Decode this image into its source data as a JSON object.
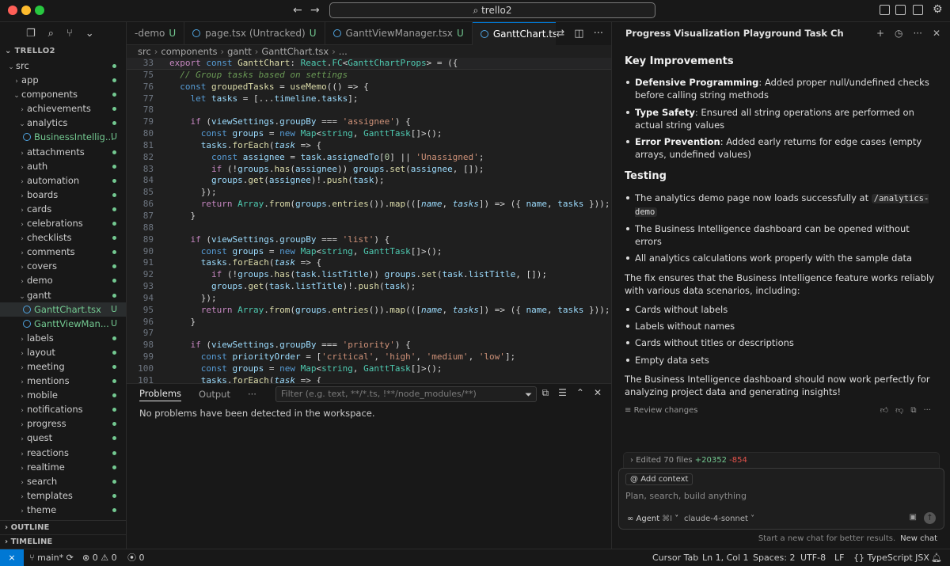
{
  "titlebar": {
    "search_text": "trello2",
    "nav_back": "←",
    "nav_forward": "→"
  },
  "sidebar": {
    "project": "TRELLO2",
    "tree": [
      {
        "label": "src",
        "depth": 0,
        "chev": "⌄",
        "dot": true
      },
      {
        "label": "app",
        "depth": 1,
        "chev": "›",
        "dot": true
      },
      {
        "label": "components",
        "depth": 1,
        "chev": "⌄",
        "dot": true
      },
      {
        "label": "achievements",
        "depth": 2,
        "chev": "›",
        "dot": true
      },
      {
        "label": "analytics",
        "depth": 2,
        "chev": "⌄",
        "dot": true
      },
      {
        "label": "BusinessIntellig...",
        "depth": 3,
        "file": true,
        "badge": "U"
      },
      {
        "label": "attachments",
        "depth": 2,
        "chev": "›",
        "dot": true
      },
      {
        "label": "auth",
        "depth": 2,
        "chev": "›",
        "dot": true
      },
      {
        "label": "automation",
        "depth": 2,
        "chev": "›",
        "dot": true
      },
      {
        "label": "boards",
        "depth": 2,
        "chev": "›",
        "dot": true
      },
      {
        "label": "cards",
        "depth": 2,
        "chev": "›",
        "dot": true
      },
      {
        "label": "celebrations",
        "depth": 2,
        "chev": "›",
        "dot": true
      },
      {
        "label": "checklists",
        "depth": 2,
        "chev": "›",
        "dot": true
      },
      {
        "label": "comments",
        "depth": 2,
        "chev": "›",
        "dot": true
      },
      {
        "label": "covers",
        "depth": 2,
        "chev": "›",
        "dot": true
      },
      {
        "label": "demo",
        "depth": 2,
        "chev": "›",
        "dot": true
      },
      {
        "label": "gantt",
        "depth": 2,
        "chev": "⌄",
        "dot": true
      },
      {
        "label": "GanttChart.tsx",
        "depth": 3,
        "file": true,
        "badge": "U",
        "selected": true
      },
      {
        "label": "GanttViewMan...",
        "depth": 3,
        "file": true,
        "badge": "U"
      },
      {
        "label": "labels",
        "depth": 2,
        "chev": "›",
        "dot": true
      },
      {
        "label": "layout",
        "depth": 2,
        "chev": "›",
        "dot": true
      },
      {
        "label": "meeting",
        "depth": 2,
        "chev": "›",
        "dot": true
      },
      {
        "label": "mentions",
        "depth": 2,
        "chev": "›",
        "dot": true
      },
      {
        "label": "mobile",
        "depth": 2,
        "chev": "›",
        "dot": true
      },
      {
        "label": "notifications",
        "depth": 2,
        "chev": "›",
        "dot": true
      },
      {
        "label": "progress",
        "depth": 2,
        "chev": "›",
        "dot": true
      },
      {
        "label": "quest",
        "depth": 2,
        "chev": "›",
        "dot": true
      },
      {
        "label": "reactions",
        "depth": 2,
        "chev": "›",
        "dot": true
      },
      {
        "label": "realtime",
        "depth": 2,
        "chev": "›",
        "dot": true
      },
      {
        "label": "search",
        "depth": 2,
        "chev": "›",
        "dot": true
      },
      {
        "label": "templates",
        "depth": 2,
        "chev": "›",
        "dot": true
      },
      {
        "label": "theme",
        "depth": 2,
        "chev": "›",
        "dot": true
      }
    ],
    "outline": "OUTLINE",
    "timeline": "TIMELINE"
  },
  "tabs": [
    {
      "label": "-demo",
      "badge": "U",
      "active": false,
      "icon": false
    },
    {
      "label": "page.tsx (Untracked)",
      "badge": "U",
      "active": false,
      "icon": true
    },
    {
      "label": "GanttViewManager.tsx",
      "badge": "U",
      "active": false,
      "icon": true
    },
    {
      "label": "GanttChart.tsx",
      "badge": "U",
      "active": true,
      "icon": true
    }
  ],
  "breadcrumb": [
    "src",
    "components",
    "gantt",
    "GanttChart.tsx",
    "..."
  ],
  "code": {
    "sticky": {
      "ln": "33",
      "html": "<span class=\"kw\">export</span> <span class=\"k2\">const</span> <span class=\"fn\">GanttChart</span><span class=\"pl\">: </span><span class=\"ty\">React</span><span class=\"pl\">.</span><span class=\"ty\">FC</span><span class=\"pl\">&lt;</span><span class=\"ty\">GanttChartProps</span><span class=\"pl\">&gt; = ({</span>"
    },
    "lines": [
      {
        "ln": "75",
        "html": "  <span class=\"cm\">// Group tasks based on settings</span>"
      },
      {
        "ln": "76",
        "html": "  <span class=\"k2\">const</span> <span class=\"fn\">groupedTasks</span> <span class=\"pl\">=</span> <span class=\"fn\">useMemo</span><span class=\"pl\">(() =&gt; {</span>"
      },
      {
        "ln": "77",
        "html": "    <span class=\"k2\">let</span> <span class=\"vr\">tasks</span> <span class=\"pl\">= [...</span><span class=\"vr\">timeline</span><span class=\"pl\">.</span><span class=\"vr\">tasks</span><span class=\"pl\">];</span>"
      },
      {
        "ln": "78",
        "html": ""
      },
      {
        "ln": "79",
        "html": "    <span class=\"kw\">if</span> <span class=\"pl\">(</span><span class=\"vr\">viewSettings</span><span class=\"pl\">.</span><span class=\"vr\">groupBy</span> <span class=\"pl\">===</span> <span class=\"str\">'assignee'</span><span class=\"pl\">) {</span>"
      },
      {
        "ln": "80",
        "html": "      <span class=\"k2\">const</span> <span class=\"vr\">groups</span> <span class=\"pl\">=</span> <span class=\"k2\">new</span> <span class=\"ty\">Map</span><span class=\"pl\">&lt;</span><span class=\"ty\">string</span><span class=\"pl\">, </span><span class=\"ty\">GanttTask</span><span class=\"pl\">[]&gt;();</span>"
      },
      {
        "ln": "81",
        "html": "      <span class=\"vr\">tasks</span><span class=\"pl\">.</span><span class=\"fn\">forEach</span><span class=\"pl\">(</span><span class=\"it\">task</span> <span class=\"pl\">=&gt; {</span>"
      },
      {
        "ln": "82",
        "html": "        <span class=\"k2\">const</span> <span class=\"vr\">assignee</span> <span class=\"pl\">=</span> <span class=\"vr\">task</span><span class=\"pl\">.</span><span class=\"vr\">assignedTo</span><span class=\"pl\">[</span><span class=\"num\">0</span><span class=\"pl\">] ||</span> <span class=\"str\">'Unassigned'</span><span class=\"pl\">;</span>"
      },
      {
        "ln": "83",
        "html": "        <span class=\"kw\">if</span> <span class=\"pl\">(!</span><span class=\"vr\">groups</span><span class=\"pl\">.</span><span class=\"fn\">has</span><span class=\"pl\">(</span><span class=\"vr\">assignee</span><span class=\"pl\">)) </span><span class=\"vr\">groups</span><span class=\"pl\">.</span><span class=\"fn\">set</span><span class=\"pl\">(</span><span class=\"vr\">assignee</span><span class=\"pl\">, []);</span>"
      },
      {
        "ln": "84",
        "html": "        <span class=\"vr\">groups</span><span class=\"pl\">.</span><span class=\"fn\">get</span><span class=\"pl\">(</span><span class=\"vr\">assignee</span><span class=\"pl\">)!.</span><span class=\"fn\">push</span><span class=\"pl\">(</span><span class=\"vr\">task</span><span class=\"pl\">);</span>"
      },
      {
        "ln": "85",
        "html": "      <span class=\"pl\">});</span>"
      },
      {
        "ln": "86",
        "html": "      <span class=\"kw\">return</span> <span class=\"ty\">Array</span><span class=\"pl\">.</span><span class=\"fn\">from</span><span class=\"pl\">(</span><span class=\"vr\">groups</span><span class=\"pl\">.</span><span class=\"fn\">entries</span><span class=\"pl\">()).</span><span class=\"fn\">map</span><span class=\"pl\">(([</span><span class=\"it\">name</span><span class=\"pl\">, </span><span class=\"it\">tasks</span><span class=\"pl\">]) =&gt; ({ </span><span class=\"vr\">name</span><span class=\"pl\">, </span><span class=\"vr\">tasks</span> <span class=\"pl\">}));</span>"
      },
      {
        "ln": "87",
        "html": "    <span class=\"pl\">}</span>"
      },
      {
        "ln": "88",
        "html": ""
      },
      {
        "ln": "89",
        "html": "    <span class=\"kw\">if</span> <span class=\"pl\">(</span><span class=\"vr\">viewSettings</span><span class=\"pl\">.</span><span class=\"vr\">groupBy</span> <span class=\"pl\">===</span> <span class=\"str\">'list'</span><span class=\"pl\">) {</span>"
      },
      {
        "ln": "90",
        "html": "      <span class=\"k2\">const</span> <span class=\"vr\">groups</span> <span class=\"pl\">=</span> <span class=\"k2\">new</span> <span class=\"ty\">Map</span><span class=\"pl\">&lt;</span><span class=\"ty\">string</span><span class=\"pl\">, </span><span class=\"ty\">GanttTask</span><span class=\"pl\">[]&gt;();</span>"
      },
      {
        "ln": "91",
        "html": "      <span class=\"vr\">tasks</span><span class=\"pl\">.</span><span class=\"fn\">forEach</span><span class=\"pl\">(</span><span class=\"it\">task</span> <span class=\"pl\">=&gt; {</span>"
      },
      {
        "ln": "92",
        "html": "        <span class=\"kw\">if</span> <span class=\"pl\">(!</span><span class=\"vr\">groups</span><span class=\"pl\">.</span><span class=\"fn\">has</span><span class=\"pl\">(</span><span class=\"vr\">task</span><span class=\"pl\">.</span><span class=\"vr\">listTitle</span><span class=\"pl\">)) </span><span class=\"vr\">groups</span><span class=\"pl\">.</span><span class=\"fn\">set</span><span class=\"pl\">(</span><span class=\"vr\">task</span><span class=\"pl\">.</span><span class=\"vr\">listTitle</span><span class=\"pl\">, []);</span>"
      },
      {
        "ln": "93",
        "html": "        <span class=\"vr\">groups</span><span class=\"pl\">.</span><span class=\"fn\">get</span><span class=\"pl\">(</span><span class=\"vr\">task</span><span class=\"pl\">.</span><span class=\"vr\">listTitle</span><span class=\"pl\">)!.</span><span class=\"fn\">push</span><span class=\"pl\">(</span><span class=\"vr\">task</span><span class=\"pl\">);</span>"
      },
      {
        "ln": "94",
        "html": "      <span class=\"pl\">});</span>"
      },
      {
        "ln": "95",
        "html": "      <span class=\"kw\">return</span> <span class=\"ty\">Array</span><span class=\"pl\">.</span><span class=\"fn\">from</span><span class=\"pl\">(</span><span class=\"vr\">groups</span><span class=\"pl\">.</span><span class=\"fn\">entries</span><span class=\"pl\">()).</span><span class=\"fn\">map</span><span class=\"pl\">(([</span><span class=\"it\">name</span><span class=\"pl\">, </span><span class=\"it\">tasks</span><span class=\"pl\">]) =&gt; ({ </span><span class=\"vr\">name</span><span class=\"pl\">, </span><span class=\"vr\">tasks</span> <span class=\"pl\">}));</span>"
      },
      {
        "ln": "96",
        "html": "    <span class=\"pl\">}</span>"
      },
      {
        "ln": "97",
        "html": ""
      },
      {
        "ln": "98",
        "html": "    <span class=\"kw\">if</span> <span class=\"pl\">(</span><span class=\"vr\">viewSettings</span><span class=\"pl\">.</span><span class=\"vr\">groupBy</span> <span class=\"pl\">===</span> <span class=\"str\">'priority'</span><span class=\"pl\">) {</span>"
      },
      {
        "ln": "99",
        "html": "      <span class=\"k2\">const</span> <span class=\"vr\">priorityOrder</span> <span class=\"pl\">= [</span><span class=\"str\">'critical'</span><span class=\"pl\">, </span><span class=\"str\">'high'</span><span class=\"pl\">, </span><span class=\"str\">'medium'</span><span class=\"pl\">, </span><span class=\"str\">'low'</span><span class=\"pl\">];</span>"
      },
      {
        "ln": "100",
        "html": "      <span class=\"k2\">const</span> <span class=\"vr\">groups</span> <span class=\"pl\">=</span> <span class=\"k2\">new</span> <span class=\"ty\">Map</span><span class=\"pl\">&lt;</span><span class=\"ty\">string</span><span class=\"pl\">, </span><span class=\"ty\">GanttTask</span><span class=\"pl\">[]&gt;();</span>"
      },
      {
        "ln": "101",
        "html": "      <span class=\"vr\">tasks</span><span class=\"pl\">.</span><span class=\"fn\">forEach</span><span class=\"pl\">(</span><span class=\"it\">task</span> <span class=\"pl\">=&gt; {</span>"
      }
    ]
  },
  "panel": {
    "tab_problems": "Problems",
    "tab_output": "Output",
    "more": "···",
    "filter_placeholder": "Filter (e.g. text, **/*.ts, !**/node_modules/**)",
    "message": "No problems have been detected in the workspace."
  },
  "chat": {
    "title": "Progress Visualization Playground Task Ch",
    "h_improvements": "Key Improvements",
    "improvements": [
      {
        "bold": "Defensive Programming",
        "text": ": Added proper null/undefined checks before calling string methods"
      },
      {
        "bold": "Type Safety",
        "text": ": Ensured all string operations are performed on actual string values"
      },
      {
        "bold": "Error Prevention",
        "text": ": Added early returns for edge cases (empty arrays, undefined values)"
      }
    ],
    "h_testing": "Testing",
    "testing_1_pre": "The analytics demo page now loads successfully at ",
    "testing_1_code": "/analytics-demo",
    "testing_2": "The Business Intelligence dashboard can be opened without errors",
    "testing_3": "All analytics calculations work properly with the sample data",
    "fix_para": "The fix ensures that the Business Intelligence feature works reliably with various data scenarios, including:",
    "scenarios": [
      "Cards without labels",
      "Labels without names",
      "Cards without titles or descriptions",
      "Empty data sets"
    ],
    "closing": "The Business Intelligence dashboard should now work perfectly for analyzing project data and generating insights!",
    "review_changes": "Review changes",
    "edited_prefix": "Edited 70 files",
    "edited_plus": "+20352",
    "edited_minus": "-854",
    "add_context": "Add context",
    "composer_placeholder": "Plan, search, build anything",
    "agent_label": "Agent",
    "agent_shortcut": "⌘I",
    "model": "claude-4-sonnet",
    "footer_hint": "Start a new chat for better results.",
    "footer_new": "New chat"
  },
  "statusbar": {
    "branch": "main*",
    "errors": "0",
    "warnings": "0",
    "ports": "0",
    "cursor_tab": "Cursor Tab",
    "position": "Ln 1, Col 1",
    "spaces": "Spaces: 2",
    "encoding": "UTF-8",
    "eol": "LF",
    "language": "TypeScript JSX"
  }
}
